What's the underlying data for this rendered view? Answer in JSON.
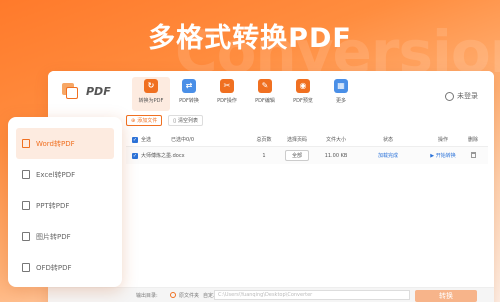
{
  "hero": {
    "title": "多格式转换PDF",
    "watermark": "Conversion"
  },
  "app": {
    "name": "PDF"
  },
  "window_controls": {
    "min": "—",
    "max": "□",
    "close": "✕"
  },
  "tabs": [
    {
      "label": "转换为PDF",
      "color": "#f07021",
      "glyph": "↻",
      "active": true
    },
    {
      "label": "PDF转换",
      "color": "#4a8fe7",
      "glyph": "⇄",
      "active": false
    },
    {
      "label": "PDF操作",
      "color": "#f07021",
      "glyph": "✂",
      "active": false
    },
    {
      "label": "PDF编辑",
      "color": "#f07021",
      "glyph": "✎",
      "active": false
    },
    {
      "label": "PDF预览",
      "color": "#f07021",
      "glyph": "◉",
      "active": false
    },
    {
      "label": "更多",
      "color": "#4a8fe7",
      "glyph": "▦",
      "active": false
    }
  ],
  "user": {
    "label": "未登录"
  },
  "sidebar": {
    "items": [
      {
        "label": "Word转PDF",
        "active": true
      },
      {
        "label": "Excel转PDF",
        "active": false
      },
      {
        "label": "PPT转PDF",
        "active": false
      },
      {
        "label": "图片转PDF",
        "active": false
      },
      {
        "label": "OFD转PDF",
        "active": false
      }
    ]
  },
  "actions": {
    "add_file": "添加文件",
    "clear_list": "清空列表"
  },
  "table": {
    "headers": [
      "全选",
      "已选中0/0",
      "总页数",
      "选择页码",
      "文件大小",
      "状态",
      "操作",
      "删除"
    ],
    "rows": [
      {
        "name": "大师傅炼之墨.docx",
        "pages": "1",
        "select": "全部",
        "size": "11.00 KB",
        "status": "加载完成",
        "op": "▶ 开始转换"
      }
    ]
  },
  "bottom": {
    "output_label": "输出目录:",
    "option": "原文件夹",
    "path_label": "自定义",
    "path_value": "C:\\Users\\Yuanqing\\Desktop\\Converter",
    "convert": "转换"
  },
  "colors": {
    "accent": "#f07021",
    "blue": "#2a72d9"
  }
}
